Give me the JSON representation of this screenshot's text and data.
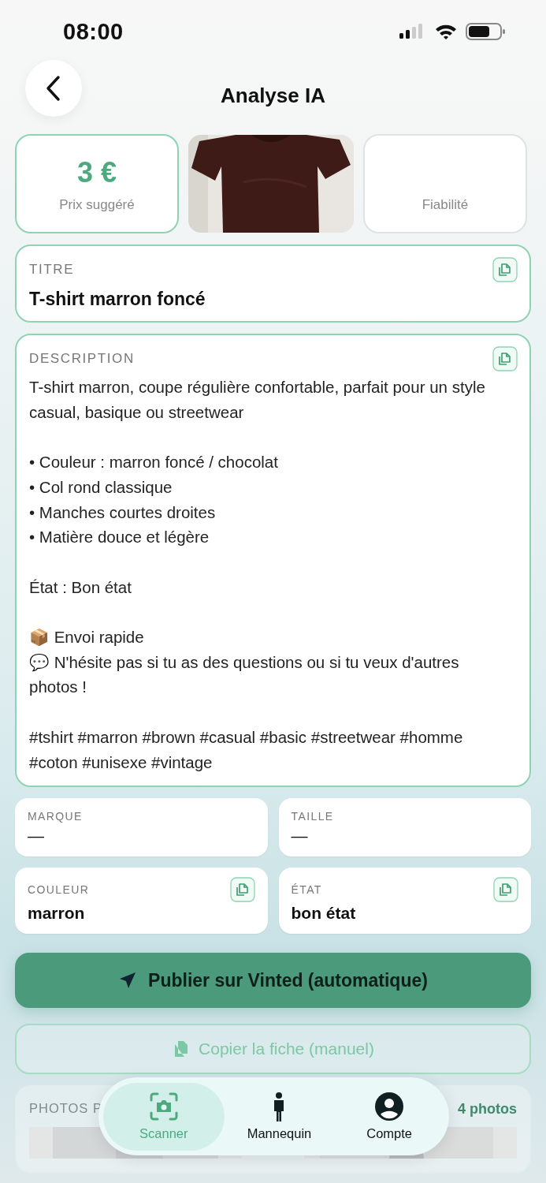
{
  "status_bar": {
    "time": "08:00"
  },
  "header": {
    "title": "Analyse IA"
  },
  "summary": {
    "price": "3 €",
    "price_label": "Prix suggéré",
    "reliability_label": "Fiabilité"
  },
  "title_card": {
    "label": "TITRE",
    "value": "T-shirt marron foncé"
  },
  "description_card": {
    "label": "DESCRIPTION",
    "text": "T-shirt marron, coupe régulière confortable, parfait pour un style casual, basique ou streetwear\n\n• Couleur : marron foncé / chocolat\n• Col rond classique\n• Manches courtes droites\n• Matière douce et légère\n\nÉtat : Bon état\n\n📦 Envoi rapide\n💬 N'hésite pas si tu as des questions ou si tu veux d'autres photos !\n\n#tshirt #marron #brown #casual #basic #streetwear #homme #coton #unisexe #vintage"
  },
  "fields": [
    {
      "label": "MARQUE",
      "value": "—",
      "copyable": false
    },
    {
      "label": "TAILLE",
      "value": "—",
      "copyable": false
    },
    {
      "label": "COULEUR",
      "value": "marron",
      "copyable": true
    },
    {
      "label": "ÉTAT",
      "value": "bon état",
      "copyable": true
    }
  ],
  "publish_button": "Publier sur Vinted (automatique)",
  "copy_button": "Copier la fiche (manuel)",
  "photos_card": {
    "label": "PHOTOS P",
    "count": "4 photos"
  },
  "tab_bar": [
    {
      "kind": "scanner",
      "label": "Scanner",
      "selected": true
    },
    {
      "kind": "person",
      "label": "Mannequin",
      "selected": false
    },
    {
      "kind": "account",
      "label": "Compte",
      "selected": false
    }
  ]
}
